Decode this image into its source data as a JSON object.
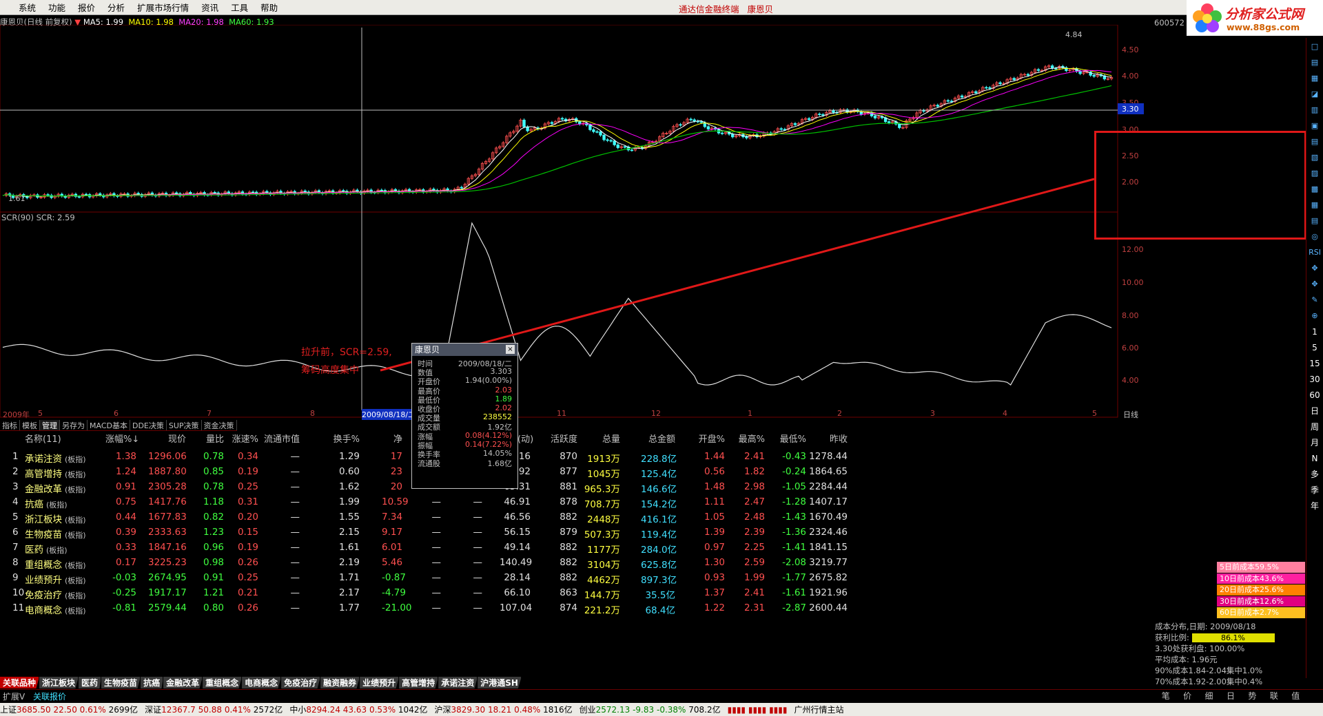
{
  "menu": [
    "系统",
    "功能",
    "报价",
    "分析",
    "扩展市场行情",
    "资讯",
    "工具",
    "帮助"
  ],
  "app_title": "通达信金融终端",
  "app_stock": "康恩贝",
  "logo": {
    "line1": "分析家公式网",
    "line2": "www.88gs.com"
  },
  "chart_header": {
    "title": "康恩贝(日线 前复权)",
    "ma5": "MA5: 1.99",
    "ma10": "MA10: 1.98",
    "ma20": "MA20: 1.98",
    "ma60": "MA60: 1.93"
  },
  "stock_code": "600572",
  "price_axis": [
    "4.50",
    "4.00",
    "3.50",
    "3.00",
    "2.50",
    "2.00"
  ],
  "current_price": "3.30",
  "high_label": "4.84",
  "low_label": "1.61",
  "scr_header": "SCR(90)  SCR: 2.59",
  "scr_axis": [
    "12.00",
    "10.00",
    "8.00",
    "6.00",
    "4.00"
  ],
  "annotation": {
    "line1": "拉升前，SCR=2.59,",
    "line2": "筹码高度集中"
  },
  "date_bar": [
    {
      "t": "2009年"
    },
    {
      "t": "5"
    },
    {
      "t": "6"
    },
    {
      "t": "7"
    },
    {
      "t": "8"
    },
    {
      "t": "2009/08/18/二"
    },
    {
      "t": "11"
    },
    {
      "t": "12"
    },
    {
      "t": "1"
    },
    {
      "t": "2"
    },
    {
      "t": "3"
    },
    {
      "t": "4"
    },
    {
      "t": "5"
    }
  ],
  "period_label": "日线",
  "tabs": [
    "指标",
    "模板",
    "管理",
    "另存为",
    "MACD基本",
    "DDE决策",
    "SUP决策",
    "资金决策"
  ],
  "popup": {
    "title": "康恩贝",
    "rows": [
      {
        "k": "时间",
        "v": "2009/08/18/二"
      },
      {
        "k": "数值",
        "v": "3.303"
      },
      {
        "k": "开盘价",
        "v": "1.94(0.00%)"
      },
      {
        "k": "最高价",
        "v": "2.03"
      },
      {
        "k": "最低价",
        "v": "1.89"
      },
      {
        "k": "收盘价",
        "v": "2.02"
      },
      {
        "k": "成交量",
        "v": "238552"
      },
      {
        "k": "成交额",
        "v": "1.92亿"
      },
      {
        "k": "涨幅",
        "v": "0.08(4.12%)"
      },
      {
        "k": "振幅",
        "v": "0.14(7.22%)"
      },
      {
        "k": "换手率",
        "v": "14.05%"
      },
      {
        "k": "流通股",
        "v": "1.68亿"
      }
    ]
  },
  "table": {
    "headers": [
      "名称(11)",
      "涨幅%↓",
      "现价",
      "量比",
      "涨速%",
      "流通市值",
      "换手%",
      "净",
      "",
      "",
      "市盈(动)",
      "活跃度",
      "总量",
      "总金额",
      "开盘%",
      "最高%",
      "最低%",
      "昨收"
    ],
    "rows": [
      {
        "n": "1",
        "name": "承诺注资",
        "tag": "(板指)",
        "c": [
          "1.38",
          "1296.06",
          "0.78",
          "0.34",
          "—",
          "1.29",
          "17",
          "",
          "",
          "44.16",
          "870",
          "1913万",
          "228.8亿",
          "1.44",
          "2.41",
          "-0.43",
          "1278.44"
        ]
      },
      {
        "n": "2",
        "name": "高管增持",
        "tag": "(板指)",
        "c": [
          "1.24",
          "1887.80",
          "0.85",
          "0.19",
          "—",
          "0.60",
          "23",
          "",
          "",
          "31.92",
          "877",
          "1045万",
          "125.4亿",
          "0.56",
          "1.82",
          "-0.24",
          "1864.65"
        ]
      },
      {
        "n": "3",
        "name": "金融改革",
        "tag": "(板指)",
        "c": [
          "0.91",
          "2305.28",
          "0.78",
          "0.25",
          "—",
          "1.62",
          "20",
          "",
          "",
          "65.31",
          "881",
          "965.3万",
          "146.6亿",
          "1.48",
          "2.98",
          "-1.05",
          "2284.44"
        ]
      },
      {
        "n": "4",
        "name": "抗癌",
        "tag": "(板指)",
        "c": [
          "0.75",
          "1417.76",
          "1.18",
          "0.31",
          "—",
          "1.99",
          "10.59",
          "—",
          "—",
          "46.91",
          "878",
          "708.7万",
          "154.2亿",
          "1.11",
          "2.47",
          "-1.28",
          "1407.17"
        ]
      },
      {
        "n": "5",
        "name": "浙江板块",
        "tag": "(板指)",
        "c": [
          "0.44",
          "1677.83",
          "0.82",
          "0.20",
          "—",
          "1.55",
          "7.34",
          "—",
          "—",
          "46.56",
          "882",
          "2448万",
          "416.1亿",
          "1.05",
          "2.48",
          "-1.43",
          "1670.49"
        ]
      },
      {
        "n": "6",
        "name": "生物疫苗",
        "tag": "(板指)",
        "c": [
          "0.39",
          "2333.63",
          "1.23",
          "0.15",
          "—",
          "2.15",
          "9.17",
          "—",
          "—",
          "56.15",
          "879",
          "507.3万",
          "119.4亿",
          "1.39",
          "2.39",
          "-1.36",
          "2324.46"
        ]
      },
      {
        "n": "7",
        "name": "医药",
        "tag": "(板指)",
        "c": [
          "0.33",
          "1847.16",
          "0.96",
          "0.19",
          "—",
          "1.61",
          "6.01",
          "—",
          "—",
          "49.14",
          "882",
          "1177万",
          "284.0亿",
          "0.97",
          "2.25",
          "-1.41",
          "1841.15"
        ]
      },
      {
        "n": "8",
        "name": "重组概念",
        "tag": "(板指)",
        "c": [
          "0.17",
          "3225.23",
          "0.98",
          "0.26",
          "—",
          "2.19",
          "5.46",
          "—",
          "—",
          "140.49",
          "882",
          "3104万",
          "625.8亿",
          "1.30",
          "2.59",
          "-2.08",
          "3219.77"
        ]
      },
      {
        "n": "9",
        "name": "业绩预升",
        "tag": "(板指)",
        "c": [
          "-0.03",
          "2674.95",
          "0.91",
          "0.25",
          "—",
          "1.71",
          "-0.87",
          "—",
          "—",
          "28.14",
          "882",
          "4462万",
          "897.3亿",
          "0.93",
          "1.99",
          "-1.77",
          "2675.82"
        ]
      },
      {
        "n": "10",
        "name": "免疫治疗",
        "tag": "(板指)",
        "c": [
          "-0.25",
          "1917.17",
          "1.21",
          "0.21",
          "—",
          "2.17",
          "-4.79",
          "—",
          "—",
          "66.10",
          "863",
          "144.7万",
          "35.5亿",
          "1.37",
          "2.41",
          "-1.61",
          "1921.96"
        ]
      },
      {
        "n": "11",
        "name": "电商概念",
        "tag": "(板指)",
        "c": [
          "-0.81",
          "2579.44",
          "0.80",
          "0.26",
          "—",
          "1.77",
          "-21.00",
          "—",
          "—",
          "107.04",
          "874",
          "221.2万",
          "68.4亿",
          "1.22",
          "2.31",
          "-2.87",
          "2600.44"
        ]
      }
    ]
  },
  "sectors": [
    "关联品种",
    "浙江板块",
    "医药",
    "生物疫苗",
    "抗癌",
    "金融改革",
    "重组概念",
    "电商概念",
    "免疫治疗",
    "融资融券",
    "业绩预升",
    "高管增持",
    "承诺注资",
    "沪港通SH"
  ],
  "subbar": {
    "left": "扩展V",
    "right": "关联报价"
  },
  "cost_legend": [
    {
      "t": "5日前成本59.5%",
      "c": "#ff80a0"
    },
    {
      "t": "10日前成本43.6%",
      "c": "#ff20a0"
    },
    {
      "t": "20日前成本25.6%",
      "c": "#ff8000"
    },
    {
      "t": "30日前成本12.6%",
      "c": "#e00080"
    },
    {
      "t": "60日前成本2.7%",
      "c": "#ffc020"
    }
  ],
  "cost_info": {
    "date": "成本分布,日期: 2009/08/18",
    "profit_label": "获利比例:",
    "profit_value": "86.1%",
    "line3": "3.30处获利盘: 100.00%",
    "line4": "平均成本: 1.96元",
    "line5": "90%成本1.84-2.04集中1.0%",
    "line6": "70%成本1.92-2.00集中0.4%"
  },
  "bottom_right_tabs": [
    "笔",
    "价",
    "细",
    "日",
    "势",
    "联",
    "值"
  ],
  "statusbar": {
    "sh": {
      "name": "上证",
      "price": "3685.50",
      "chg": "22.50",
      "pct": "0.61%",
      "amt": "2699亿"
    },
    "sz": {
      "name": "深证",
      "price": "12367.7",
      "chg": "50.88",
      "pct": "0.41%",
      "amt": "2572亿"
    },
    "zx": {
      "name": "中小",
      "price": "8294.24",
      "chg": "43.63",
      "pct": "0.53%",
      "amt": "1042亿"
    },
    "hs": {
      "name": "沪深",
      "price": "3829.30",
      "chg": "18.21",
      "pct": "0.48%",
      "amt": "1816亿"
    },
    "cy": {
      "name": "创业",
      "price": "2572.13",
      "chg": "-9.83",
      "pct": "-0.38%",
      "amt": "708.2亿"
    },
    "server": "广州行情主站"
  },
  "right_tools": [
    "□",
    "▤",
    "▦",
    "◪",
    "▥",
    "▣",
    "▤",
    "▧",
    "▨",
    "▩",
    "▦",
    "▤",
    "◎",
    "RSI",
    "✥",
    "✥",
    "✎",
    "⊕",
    "1",
    "5",
    "15",
    "30",
    "60",
    "日",
    "周",
    "月",
    "N",
    "多",
    "季",
    "年"
  ],
  "colors": {
    "up": "#ff5050",
    "down": "#40ff40",
    "ma5": "#ffffff",
    "ma10": "#ffff00",
    "ma20": "#ff00ff",
    "ma60": "#00ff00",
    "scr": "#ffffff"
  }
}
